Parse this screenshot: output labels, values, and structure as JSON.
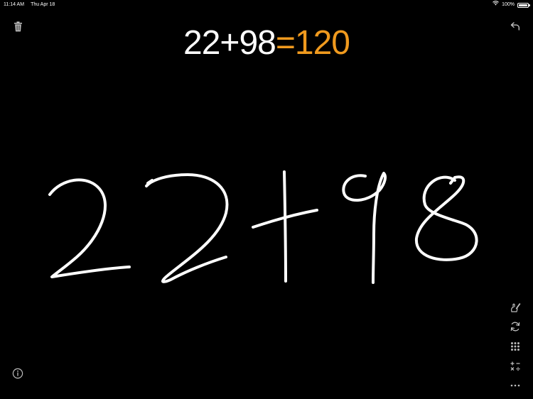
{
  "status_bar": {
    "time": "11:14 AM",
    "date": "Thu Apr 18",
    "battery": "100%"
  },
  "equation": {
    "expression": "22+98",
    "equals": "=",
    "result": "120"
  },
  "handwriting": {
    "recognized_text": "22+98"
  },
  "colors": {
    "background": "#000000",
    "text": "#ffffff",
    "accent": "#f09a1e",
    "icon": "#bdbdbd"
  },
  "icons": {
    "trash": "trash-icon",
    "undo": "undo-icon",
    "info": "info-icon",
    "handwriting": "pen-hand-icon",
    "convert": "rotate-icon",
    "keypad": "keypad-icon",
    "operators": "operators-icon",
    "more": "more-icon"
  }
}
